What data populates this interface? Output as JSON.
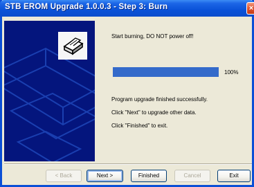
{
  "window": {
    "title": "STB EROM Upgrade 1.0.0.3 - Step 3: Burn"
  },
  "status": {
    "start_message": "Start burning, DO NOT power off!",
    "progress": 1.0,
    "progress_label": "100%",
    "success_message": "Program upgrade finished successfully.",
    "next_hint": "Click \"Next\" to upgrade other data.",
    "finish_hint": "Click \"Finished\" to exit."
  },
  "buttons": {
    "back": "< Back",
    "next": "Next >",
    "finished": "Finished",
    "cancel": "Cancel",
    "exit": "Exit"
  },
  "colors": {
    "title_bar": "#0a52d8",
    "progress_fill": "#346aca",
    "side_panel": "#04157d"
  }
}
